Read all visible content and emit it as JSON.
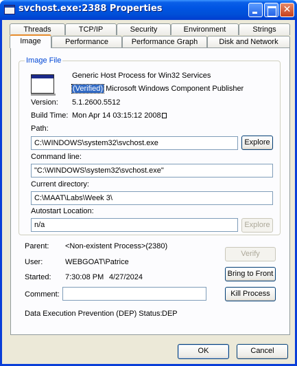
{
  "window": {
    "title": "svchost.exe:2388 Properties"
  },
  "tabs_row1": [
    "Threads",
    "TCP/IP",
    "Security",
    "Environment",
    "Strings"
  ],
  "tabs_row2": [
    "Image",
    "Performance",
    "Performance Graph",
    "Disk and Network"
  ],
  "active_tab": "Image",
  "image_file": {
    "group_title": "Image File",
    "description": "Generic Host Process for Win32 Services",
    "verified_tag": "(Verified)",
    "publisher": " Microsoft Windows Component Publisher",
    "version_label": "Version:",
    "version_value": "5.1.2600.5512",
    "build_time_label": "Build Time:",
    "build_time_value": "Mon Apr 14 03:15:12 2008",
    "path_label": "Path:",
    "path_value": "C:\\WINDOWS\\system32\\svchost.exe",
    "explore_label": "Explore",
    "command_line_label": "Command line:",
    "command_line_value": "\"C:\\WINDOWS\\system32\\svchost.exe\"",
    "current_directory_label": "Current directory:",
    "current_directory_value": "C:\\MAAT\\Labs\\Week 3\\",
    "autostart_label": "Autostart Location:",
    "autostart_value": "n/a",
    "autostart_explore_label": "Explore"
  },
  "process": {
    "parent_label": "Parent:",
    "parent_value": "<Non-existent Process>(2380)",
    "user_label": "User:",
    "user_value": "WEBGOAT\\Patrice",
    "started_label": "Started:",
    "started_time": "7:30:08 PM",
    "started_date": "4/27/2024",
    "comment_label": "Comment:",
    "comment_value": "",
    "dep_label": "Data Execution Prevention (DEP) Status:",
    "dep_value": "DEP"
  },
  "buttons": {
    "verify": "Verify",
    "bring_to_front": "Bring to Front",
    "kill_process": "Kill Process",
    "ok": "OK",
    "cancel": "Cancel"
  }
}
